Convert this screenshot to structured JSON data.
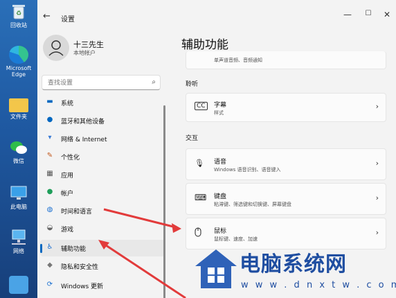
{
  "desktop": {
    "icons": [
      {
        "label": "回收站",
        "icon": "recycle-bin-icon"
      },
      {
        "label": "Microsoft Edge",
        "icon": "edge-icon"
      },
      {
        "label": "文件夹",
        "icon": "folder-icon"
      },
      {
        "label": "微信",
        "icon": "wechat-icon"
      },
      {
        "label": "此电脑",
        "icon": "computer-icon"
      },
      {
        "label": "网络",
        "icon": "network-icon"
      }
    ]
  },
  "window": {
    "title": "设置",
    "back_icon": "back-arrow-icon",
    "controls": {
      "minimize": "—",
      "maximize": "☐",
      "close": "✕"
    }
  },
  "user": {
    "name": "十三先生",
    "subtitle": "本地帐户"
  },
  "search": {
    "placeholder": "查找设置"
  },
  "nav": {
    "items": [
      {
        "label": "系统",
        "icon": "monitor-icon",
        "color": "#0067c0"
      },
      {
        "label": "蓝牙和其他设备",
        "icon": "bluetooth-icon",
        "color": "#0067c0"
      },
      {
        "label": "网络 & Internet",
        "icon": "wifi-icon",
        "color": "#3a7bd5"
      },
      {
        "label": "个性化",
        "icon": "brush-icon",
        "color": "#c2571a"
      },
      {
        "label": "应用",
        "icon": "apps-icon",
        "color": "#555"
      },
      {
        "label": "帐户",
        "icon": "person-icon",
        "color": "#1f9e5a"
      },
      {
        "label": "时间和语言",
        "icon": "globe-clock-icon",
        "color": "#1a6fd0"
      },
      {
        "label": "游戏",
        "icon": "gamepad-icon",
        "color": "#666"
      },
      {
        "label": "辅助功能",
        "icon": "accessibility-icon",
        "color": "#1a6fd0"
      },
      {
        "label": "隐私和安全性",
        "icon": "shield-icon",
        "color": "#777"
      },
      {
        "label": "Windows 更新",
        "icon": "update-icon",
        "color": "#1a6fd0"
      }
    ],
    "active_index": 8
  },
  "main": {
    "title": "辅助功能",
    "partial_card": {
      "subtitle": "单声道音频、音频通知"
    },
    "sections": [
      {
        "label": "聆听"
      },
      {
        "label": "交互"
      }
    ],
    "cards": [
      {
        "title": "字幕",
        "subtitle": "样式",
        "icon": "captions-icon"
      },
      {
        "title": "语音",
        "subtitle": "Windows 语音识别、语音键入",
        "icon": "microphone-icon"
      },
      {
        "title": "键盘",
        "subtitle": "粘滞键、筛选键和切换键、屏幕键盘",
        "icon": "keyboard-icon"
      },
      {
        "title": "鼠标",
        "subtitle": "鼠标键、速度、加速",
        "icon": "mouse-icon"
      }
    ],
    "chevron": "›"
  },
  "watermark": {
    "text": "电脑系统网",
    "url": "w w w . d n x t w . c o m"
  },
  "colors": {
    "accent": "#0067c0",
    "arrow": "#e23b3b"
  }
}
